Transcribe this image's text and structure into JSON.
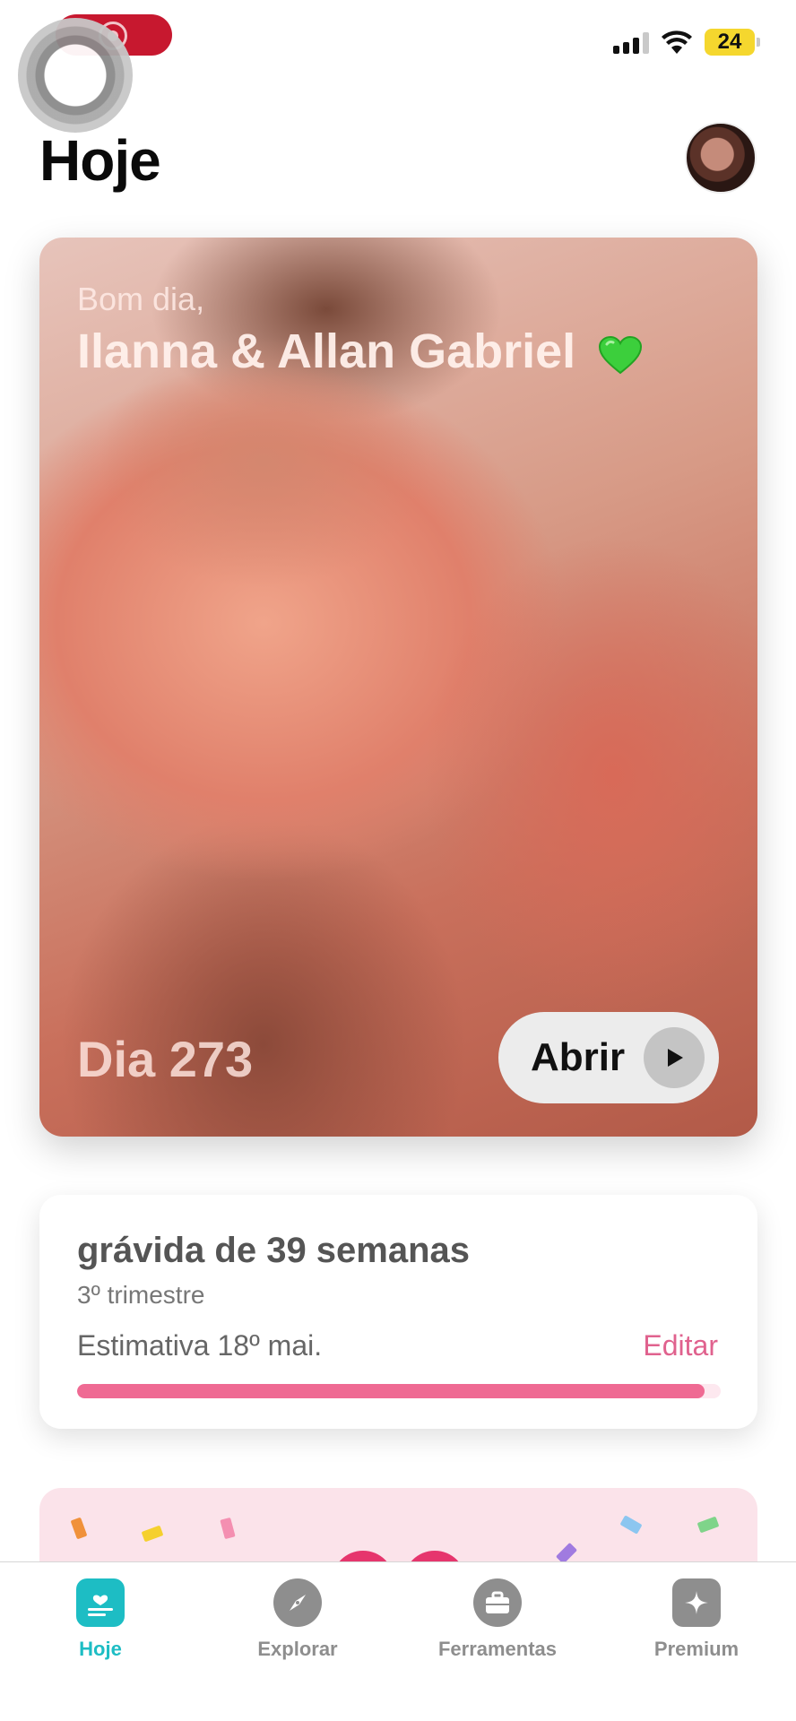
{
  "status_bar": {
    "battery": "24"
  },
  "header": {
    "title": "Hoje"
  },
  "hero": {
    "greeting": "Bom dia,",
    "names": "Ilanna & Allan Gabriel",
    "day": "Dia 273",
    "open_label": "Abrir"
  },
  "pregnancy": {
    "title": "grávida de 39 semanas",
    "trimester": "3º trimestre",
    "estimate": "Estimativa 18º mai.",
    "edit_label": "Editar",
    "progress": 0.975
  },
  "tabs": [
    {
      "label": "Hoje",
      "icon": "today-icon",
      "active": true
    },
    {
      "label": "Explorar",
      "icon": "compass-icon",
      "active": false
    },
    {
      "label": "Ferramentas",
      "icon": "briefcase-icon",
      "active": false
    },
    {
      "label": "Premium",
      "icon": "sparkle-icon",
      "active": false
    }
  ],
  "colors": {
    "accent_teal": "#1dbdc4",
    "accent_pink": "#e0628e",
    "progress_pink": "#ef6a93",
    "recording_red": "#c7182f",
    "battery_yellow": "#f5d72e"
  }
}
